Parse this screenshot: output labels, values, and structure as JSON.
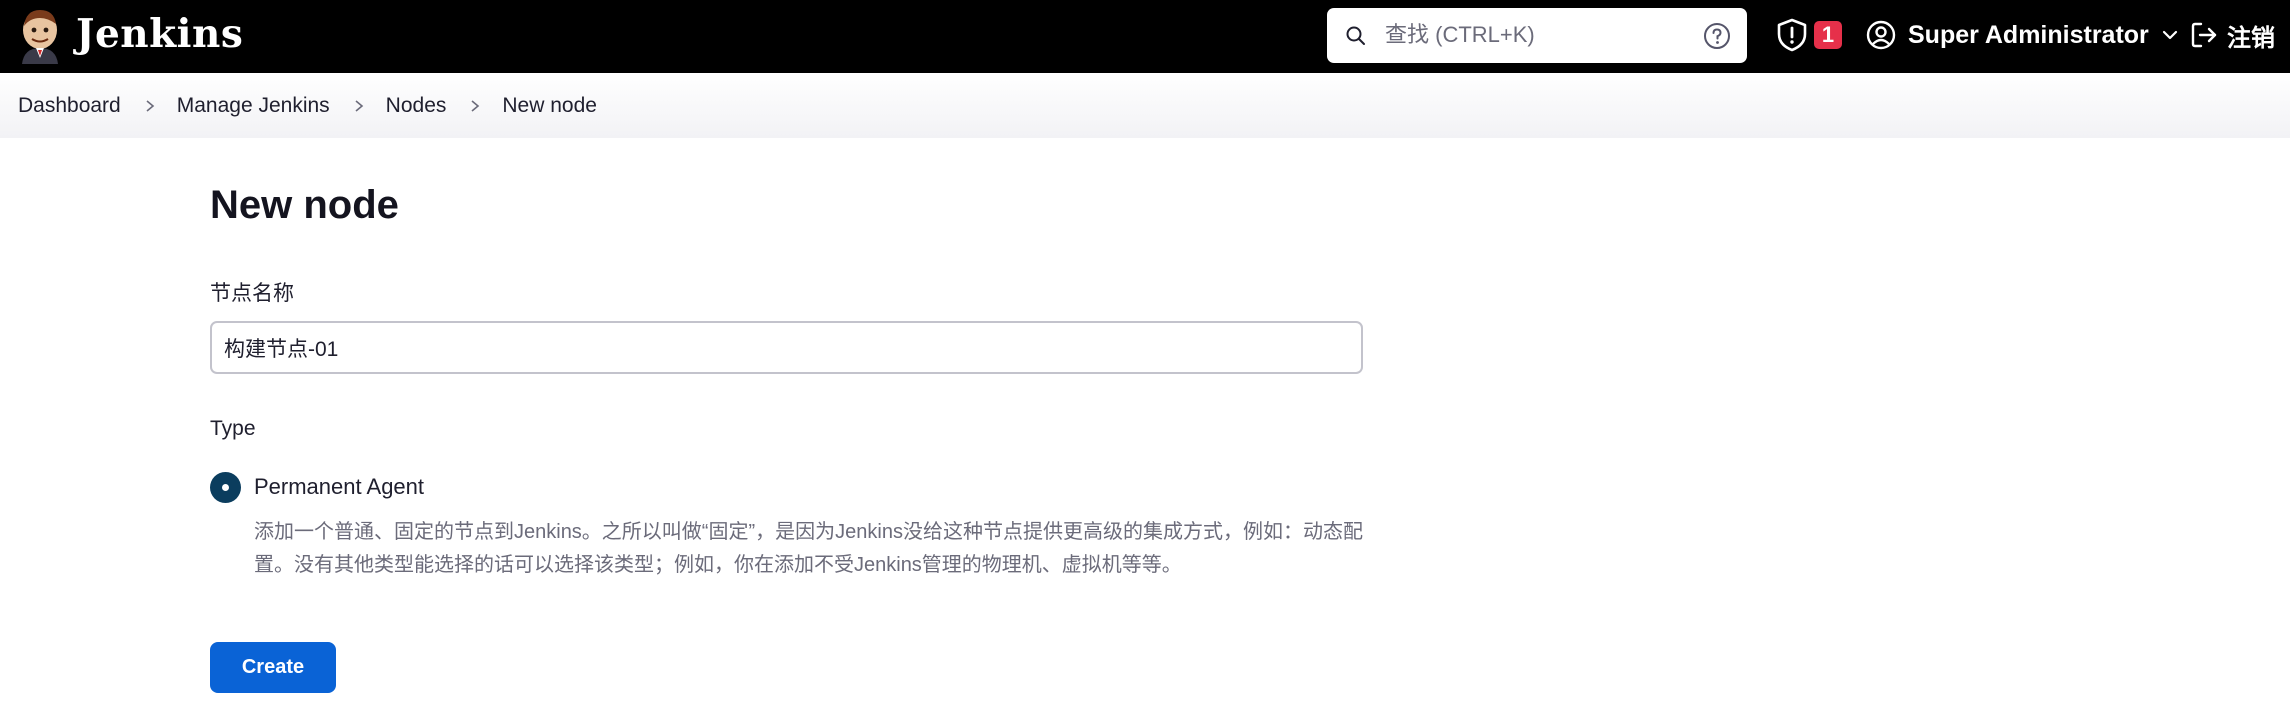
{
  "header": {
    "brand": "Jenkins",
    "search": {
      "placeholder": "查找 (CTRL+K)"
    },
    "alerts_count": "1",
    "user_name": "Super Administrator",
    "logout_label": "注销"
  },
  "breadcrumbs": [
    "Dashboard",
    "Manage Jenkins",
    "Nodes",
    "New node"
  ],
  "page": {
    "title": "New node",
    "name_label": "节点名称",
    "name_value": "构建节点-01",
    "type_label": "Type",
    "option_label": "Permanent Agent",
    "option_desc": "添加一个普通、固定的节点到Jenkins。之所以叫做“固定”，是因为Jenkins没给这种节点提供更高级的集成方式，例如：动态配置。没有其他类型能选择的话可以选择该类型；例如，你在添加不受Jenkins管理的物理机、虚拟机等等。",
    "create_label": "Create"
  },
  "colors": {
    "topbar": "#000000",
    "primary": "#0a63d6",
    "badge": "#e6304a",
    "radio": "#0b3d5e"
  },
  "icons": [
    "jenkins-logo",
    "search-icon",
    "help-icon",
    "shield-alert-icon",
    "user-circle-icon",
    "chevron-down-icon",
    "logout-icon",
    "chevron-right-icon"
  ]
}
